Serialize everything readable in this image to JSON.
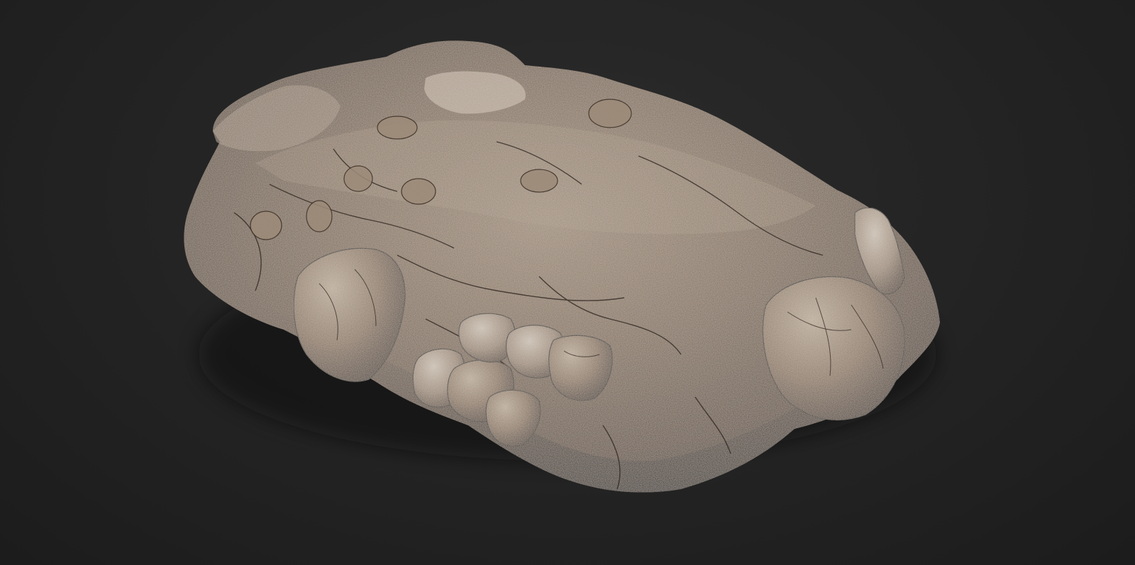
{
  "viewport": {
    "background_color": "#222222",
    "subject": "rock-model",
    "palette": {
      "base": "#6e5a48",
      "mid": "#8a7764",
      "highlight": "#b9ad9e",
      "shadow": "#3a2e25",
      "crack": "#2a211b"
    }
  }
}
